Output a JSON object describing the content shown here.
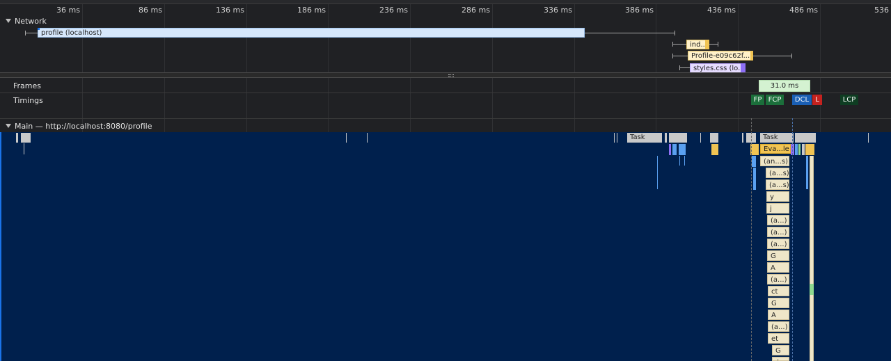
{
  "ruler": {
    "ticks": [
      "36 ms",
      "86 ms",
      "136 ms",
      "186 ms",
      "236 ms",
      "286 ms",
      "336 ms",
      "386 ms",
      "436 ms",
      "486 ms",
      "536 ms"
    ]
  },
  "tracks": {
    "network": "Network",
    "frames": "Frames",
    "timings": "Timings",
    "main": "Main — http://localhost:8080/profile"
  },
  "network": {
    "requests": [
      {
        "label": "profile (localhost)",
        "color": "#d6e7fb"
      },
      {
        "label": "ind...",
        "color": "#fff1c9"
      },
      {
        "label": "Profile-e09c62f...",
        "color": "#fff1c9"
      },
      {
        "label": "styles.css (lo...",
        "color": "#e6dcff"
      }
    ]
  },
  "frames": {
    "duration": "31.0 ms"
  },
  "timings": {
    "markers": [
      {
        "label": "FP",
        "color": "#1b6f3b"
      },
      {
        "label": "FCP",
        "color": "#1b6f3b"
      },
      {
        "label": "DCL",
        "color": "#1a5fb4"
      },
      {
        "label": "L",
        "color": "#c5221f"
      },
      {
        "label": "LCP",
        "color": "#0e3d22"
      }
    ]
  },
  "main": {
    "tasks": [
      "Task",
      "Task"
    ],
    "evaluate": "Eva...le",
    "flame_stack": [
      "(an...s)",
      "(a...s)",
      "(a...s)",
      "y",
      "j",
      "(a...)",
      "(a...)",
      "(a...)",
      "G",
      "A",
      "(a...)",
      "ct",
      "G",
      "A",
      "(a...)",
      "et",
      "G",
      "A"
    ]
  },
  "colors": {
    "background": "#202124",
    "main_bg": "#00204d",
    "task": "#c9c9c9",
    "script": "#f1c453",
    "layout": "#8e6ff5",
    "paint": "#5aa0f0"
  }
}
